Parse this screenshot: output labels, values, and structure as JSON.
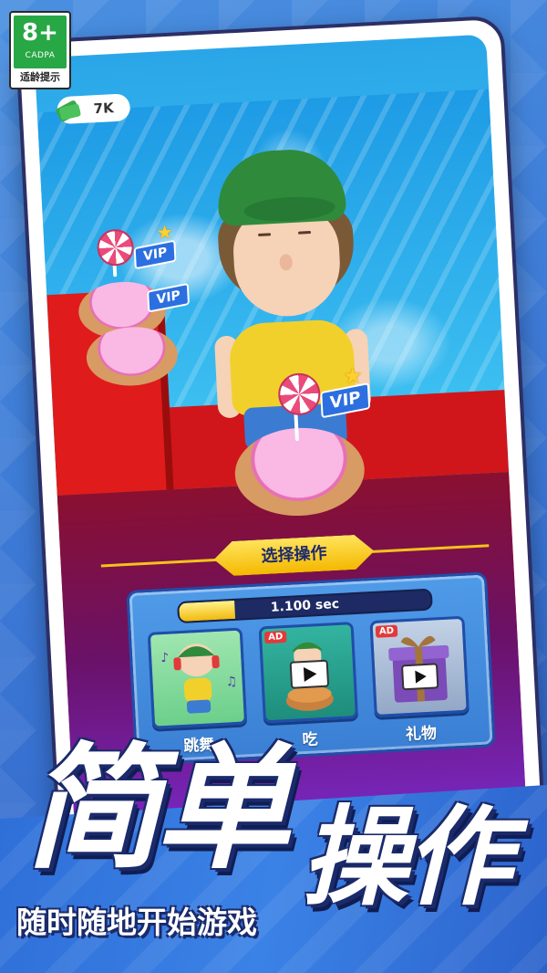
{
  "age_rating": {
    "age": "8+",
    "org": "CADPA",
    "tip": "适龄提示"
  },
  "hud": {
    "currency": "7K"
  },
  "scene": {
    "vip_label": "VIP"
  },
  "action_panel": {
    "title": "选择操作",
    "timer_text": "1.100 sec",
    "timer_progress": 0.22,
    "ad_tag": "AD",
    "actions": [
      {
        "label": "跳舞",
        "ad": false,
        "icon": "dancing-character-icon"
      },
      {
        "label": "吃",
        "ad": true,
        "icon": "eat-cake-video-icon"
      },
      {
        "label": "礼物",
        "ad": true,
        "icon": "gift-box-video-icon"
      }
    ]
  },
  "promo": {
    "headline_1": "简单",
    "headline_2": "操作",
    "subtitle": "随时随地开始游戏"
  },
  "colors": {
    "accent_yellow": "#f4b800",
    "panel_blue": "#3a7fd4",
    "badge_green": "#28a745"
  }
}
